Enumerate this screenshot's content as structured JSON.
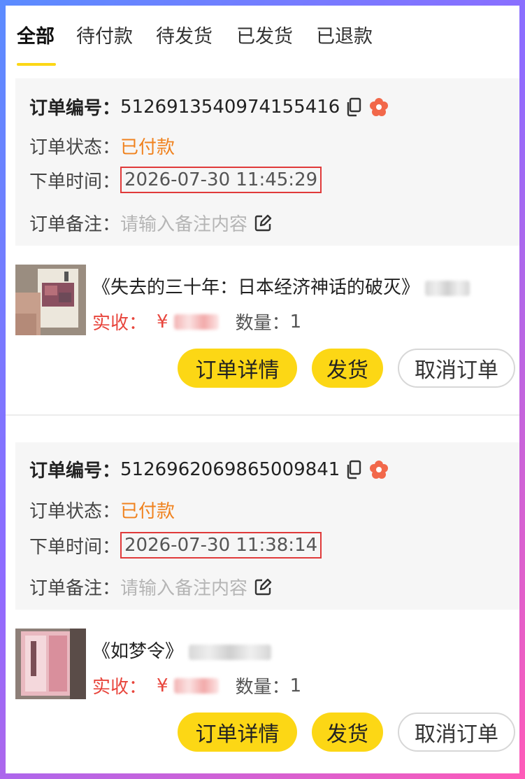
{
  "tabs": [
    {
      "label": "全部",
      "active": true
    },
    {
      "label": "待付款",
      "active": false
    },
    {
      "label": "待发货",
      "active": false
    },
    {
      "label": "已发货",
      "active": false
    },
    {
      "label": "已退款",
      "active": false
    }
  ],
  "labels": {
    "order_no": "订单编号：",
    "status": "订单状态：",
    "time": "下单时间：",
    "remark": "订单备注：",
    "remark_placeholder": "请输入备注内容",
    "paid": "实收：",
    "yen": "¥",
    "qty": "数量："
  },
  "buttons": {
    "detail": "订单详情",
    "ship": "发货",
    "cancel": "取消订单"
  },
  "orders": [
    {
      "order_no": "5126913540974155416",
      "status": "已付款",
      "time": "2026-07-30 11:45:29",
      "title": "《失去的三十年：日本经济神话的破灭》",
      "qty": "1"
    },
    {
      "order_no": "5126962069865009841",
      "status": "已付款",
      "time": "2026-07-30 11:38:14",
      "title": "《如梦令》",
      "qty": "1"
    }
  ],
  "colors": {
    "accent_yellow": "#fcd715",
    "status_orange": "#f0821e",
    "price_red": "#e8453c",
    "highlight_box": "#e03a3a"
  },
  "icons": [
    "copy-icon",
    "flower-icon",
    "edit-icon"
  ]
}
